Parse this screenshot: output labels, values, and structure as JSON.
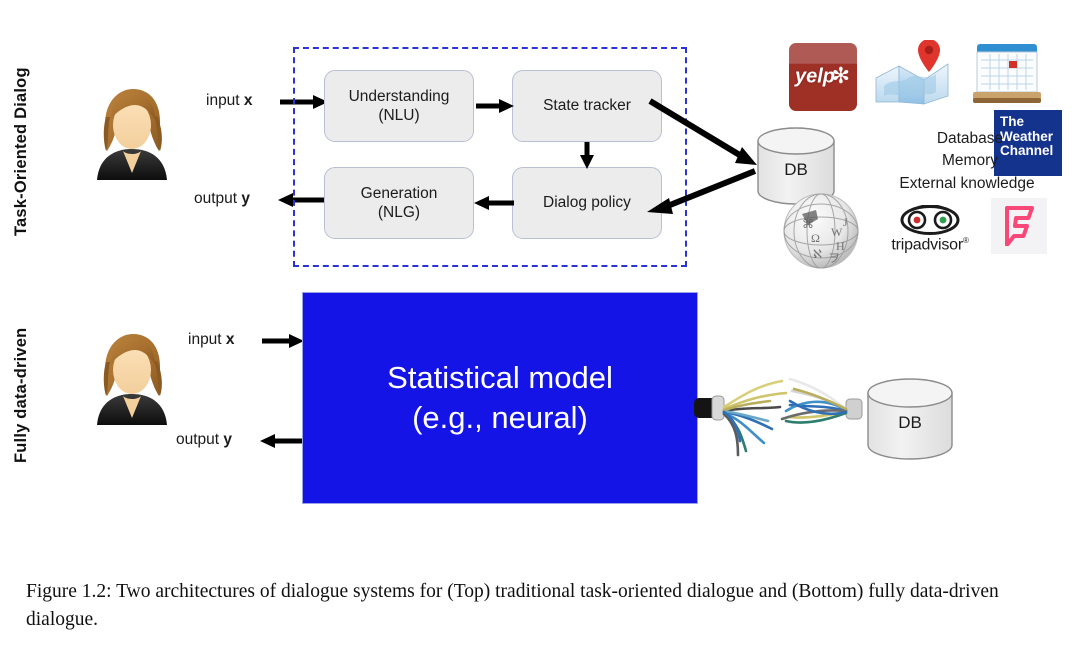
{
  "figure": {
    "caption": "Figure 1.2:  Two architectures of dialogue systems for (Top) traditional task-oriented dialogue and (Bottom) fully data-driven dialogue."
  },
  "top_panel": {
    "side_label": "Task-Oriented Dialog",
    "user_icon": "user-avatar-icon",
    "input_label_prefix": "input ",
    "input_label_var": "x",
    "output_label_prefix": "output ",
    "output_label_var": "y",
    "pipeline_boxes": [
      {
        "line1": "Understanding",
        "line2": "(NLU)"
      },
      {
        "line1": "State tracker",
        "line2": ""
      },
      {
        "line1": "Dialog policy",
        "line2": ""
      },
      {
        "line1": "Generation",
        "line2": "(NLG)"
      }
    ],
    "database": {
      "label": "DB"
    },
    "knowledge_sources": [
      "Database",
      "Memory",
      "External knowledge"
    ],
    "logos": {
      "yelp": {
        "word": "yelp",
        "burst": "✻"
      },
      "maps": "maps-icon",
      "calendar": "calendar-icon",
      "weather_channel": {
        "l1": "The",
        "l2": "Weather",
        "l3": "Channel"
      },
      "wikipedia": "wikipedia-globe-icon",
      "tripadvisor": {
        "word": "tripadvisor",
        "mark": "®"
      },
      "foursquare": "foursquare-icon"
    }
  },
  "bottom_panel": {
    "side_label": "Fully data-driven",
    "user_icon": "user-avatar-icon",
    "input_label_prefix": "input ",
    "input_label_var": "x",
    "output_label_prefix": "output ",
    "output_label_var": "y",
    "model_box": {
      "line1": "Statistical model",
      "line2": "(e.g., neural)"
    },
    "cable_icon": "frayed-cable-icon",
    "database": {
      "label": "DB"
    }
  },
  "colors": {
    "dashed_border": "#2b33d6",
    "model_box_fill": "#1414e6",
    "grey_box_fill": "#ececec",
    "grey_box_border": "#b9bfd4",
    "yelp_red": "#9e3026",
    "weather_blue": "#13338c",
    "foursquare_pink": "#f94877"
  }
}
